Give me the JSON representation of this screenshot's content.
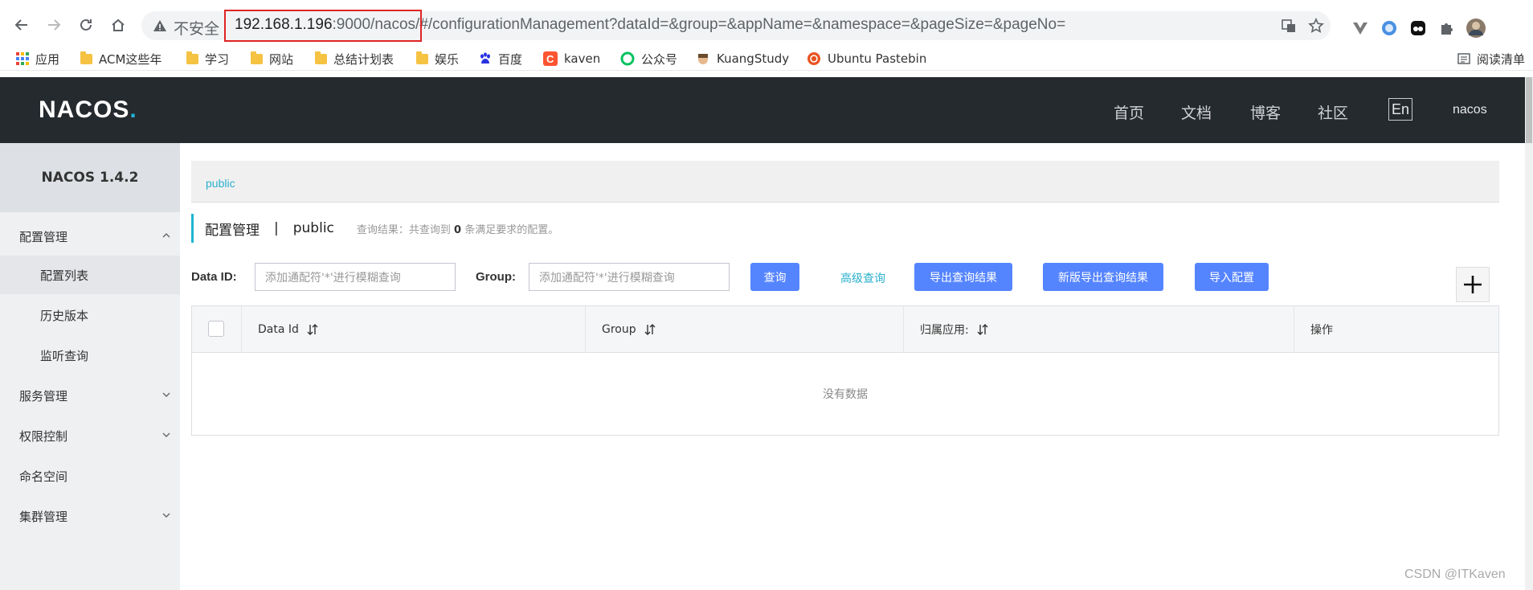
{
  "browser": {
    "insecure_label": "不安全",
    "url_host": "192.168.1.196",
    "url_port_path": ":9000/nacos/#",
    "url_rest": "/configurationManagement?dataId=&group=&appName=&namespace=&pageSize=&pageNo=",
    "bookmarks": [
      "应用",
      "ACM这些年",
      "学习",
      "网站",
      "总结计划表",
      "娱乐",
      "百度",
      "kaven",
      "公众号",
      "KuangStudy",
      "Ubuntu Pastebin"
    ],
    "reading_list": "阅读清单"
  },
  "header": {
    "logo": "NACOS",
    "logo_dot": ".",
    "nav": [
      "首页",
      "文档",
      "博客",
      "社区"
    ],
    "lang": "En",
    "user": "nacos"
  },
  "sidebar": {
    "title": "NACOS 1.4.2",
    "items": [
      {
        "label": "配置管理"
      },
      {
        "label": "配置列表"
      },
      {
        "label": "历史版本"
      },
      {
        "label": "监听查询"
      },
      {
        "label": "服务管理"
      },
      {
        "label": "权限控制"
      },
      {
        "label": "命名空间"
      },
      {
        "label": "集群管理"
      }
    ]
  },
  "main": {
    "namespace_crumb": "public",
    "title_main": "配置管理",
    "title_sep": "|",
    "title_ns": "public",
    "result_prefix": "查询结果：共查询到",
    "result_count": "0",
    "result_suffix": "条满足要求的配置。",
    "dataid_label": "Data ID:",
    "dataid_placeholder": "添加通配符'*'进行模糊查询",
    "group_label": "Group:",
    "group_placeholder": "添加通配符'*'进行模糊查询",
    "query_button": "查询",
    "advanced_query": "高级查询",
    "export_button": "导出查询结果",
    "new_export_button": "新版导出查询结果",
    "import_button": "导入配置",
    "table": {
      "columns": [
        "Data Id",
        "Group",
        "归属应用:",
        "操作"
      ],
      "empty": "没有数据"
    }
  },
  "watermark": "CSDN @ITKaven"
}
